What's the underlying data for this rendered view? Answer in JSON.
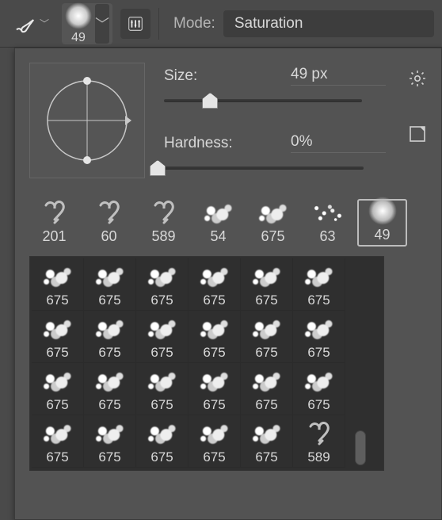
{
  "toolbar": {
    "current_size": "49",
    "mode_label": "Mode:",
    "mode_value": "Saturation"
  },
  "panel": {
    "size_label": "Size:",
    "size_value": "49 px",
    "size_percent": 0.21,
    "hardness_label": "Hardness:",
    "hardness_value": "0%",
    "hardness_percent": 0.0,
    "icons": {
      "gear": "gear-icon",
      "new": "new-preset-icon"
    }
  },
  "recent": [
    {
      "label": "201",
      "kind": "heart"
    },
    {
      "label": "60",
      "kind": "heart"
    },
    {
      "label": "589",
      "kind": "heart"
    },
    {
      "label": "54",
      "kind": "splatter"
    },
    {
      "label": "675",
      "kind": "splatter"
    },
    {
      "label": "63",
      "kind": "dots"
    },
    {
      "label": "49",
      "kind": "soft",
      "selected": true
    }
  ],
  "grid": [
    {
      "label": "675",
      "kind": "splatter"
    },
    {
      "label": "675",
      "kind": "splatter"
    },
    {
      "label": "675",
      "kind": "splatter"
    },
    {
      "label": "675",
      "kind": "splatter"
    },
    {
      "label": "675",
      "kind": "splatter"
    },
    {
      "label": "675",
      "kind": "splatter"
    },
    {
      "label": "675",
      "kind": "splatter"
    },
    {
      "label": "675",
      "kind": "splatter"
    },
    {
      "label": "675",
      "kind": "splatter"
    },
    {
      "label": "675",
      "kind": "splatter"
    },
    {
      "label": "675",
      "kind": "splatter"
    },
    {
      "label": "675",
      "kind": "splatter"
    },
    {
      "label": "675",
      "kind": "splatter"
    },
    {
      "label": "675",
      "kind": "splatter"
    },
    {
      "label": "675",
      "kind": "splatter"
    },
    {
      "label": "675",
      "kind": "splatter"
    },
    {
      "label": "675",
      "kind": "splatter"
    },
    {
      "label": "675",
      "kind": "splatter"
    },
    {
      "label": "675",
      "kind": "splatter"
    },
    {
      "label": "675",
      "kind": "splatter"
    },
    {
      "label": "675",
      "kind": "splatter"
    },
    {
      "label": "675",
      "kind": "splatter"
    },
    {
      "label": "675",
      "kind": "splatter"
    },
    {
      "label": "589",
      "kind": "heart"
    }
  ],
  "colors": {
    "bg": "#4a4a4a",
    "panel": "#535353",
    "text": "#d8d8d8"
  }
}
